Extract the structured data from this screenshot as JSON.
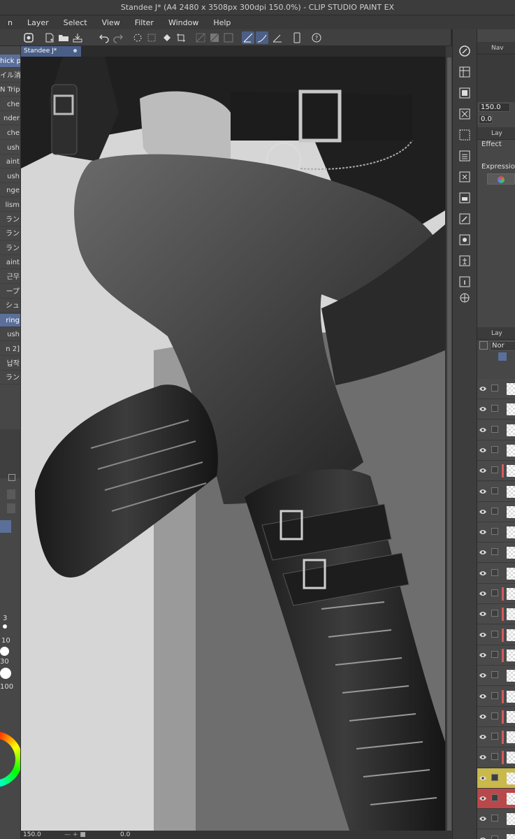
{
  "window": {
    "title": "Standee J* (A4 2480 x 3508px 300dpi 150.0%) - CLIP STUDIO PAINT EX"
  },
  "menu": [
    "n",
    "Layer",
    "Select",
    "View",
    "Filter",
    "Window",
    "Help"
  ],
  "document_tab": {
    "label": "Standee J*"
  },
  "brush_list": [
    "hick p",
    "イル消",
    "N Trip",
    "che",
    "nder",
    "che",
    "ush",
    "aint",
    "ush",
    "nge",
    "lism",
    "ラン",
    "ラン",
    "ラン",
    "aint",
    "근무",
    "ープ",
    "シュ",
    "ring",
    "ush",
    "n 2]",
    "납작",
    "ラン"
  ],
  "brush_sizes": [
    "3",
    "10",
    "30",
    "100"
  ],
  "right_panel": {
    "navigator_label": "Nav",
    "zoom_value": "150.0",
    "rotate_value": "0.0",
    "layer_property_label": "Lay",
    "effect_label": "Effect",
    "expression_label": "Expression",
    "layer_panel_label": "Lay",
    "blend_mode": "Nor"
  },
  "status": {
    "zoom": "150.0",
    "rotation": "0.0"
  },
  "colors": {
    "accent": "#5a6f9a",
    "canvas_bg": "#4a4a4a",
    "panel": "#474747"
  }
}
